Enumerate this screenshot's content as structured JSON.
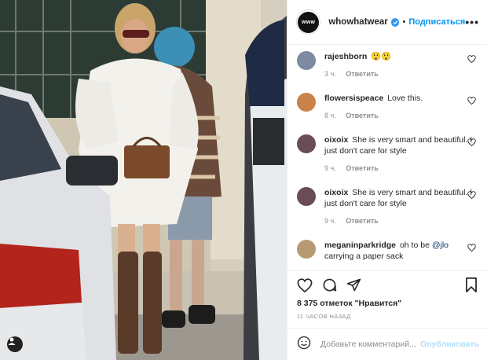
{
  "header": {
    "avatar_text": "www",
    "username": "whowhatwear",
    "dot": "•",
    "follow_label": "Подписаться",
    "more_label": "•••"
  },
  "comments": [
    {
      "user": "rajeshborn",
      "text": "😲😲",
      "time": "3 ч.",
      "reply": "Ответить",
      "avatar_color": "#7d8aa0"
    },
    {
      "user": "flowersispeace",
      "text": "Love this.",
      "time": "8 ч.",
      "reply": "Ответить",
      "avatar_color": "#c8824a"
    },
    {
      "user": "oixoix",
      "text": "She is very smart and beautiful. I just don't care for style",
      "time": "9 ч.",
      "reply": "Ответить",
      "avatar_color": "#6a4b58"
    },
    {
      "user": "oixoix",
      "text": "She is very smart and beautiful. I just don't care for style",
      "time": "9 ч.",
      "reply": "Ответить",
      "avatar_color": "#6a4b58"
    },
    {
      "user": "meganinparkridge",
      "text_before": "oh to be ",
      "mention": "@jlo",
      "text_after": " carrying a paper sack",
      "avatar_color": "#b89a72"
    }
  ],
  "likes_text": "8 375 отметок \"Нравится\"",
  "time_ago": "11 ЧАСОВ НАЗАД",
  "add_comment": {
    "placeholder": "Добавьте комментарий...",
    "publish_label": "Опубликовать"
  },
  "icons": [
    "heart-icon",
    "comment-icon",
    "share-icon",
    "bookmark-icon",
    "emoji-icon",
    "user-tag-icon",
    "verified-icon"
  ],
  "colors": {
    "accent": "#0095f6",
    "text": "#262626",
    "muted": "#8e8e8e",
    "publish_disabled": "#b2dffc"
  }
}
